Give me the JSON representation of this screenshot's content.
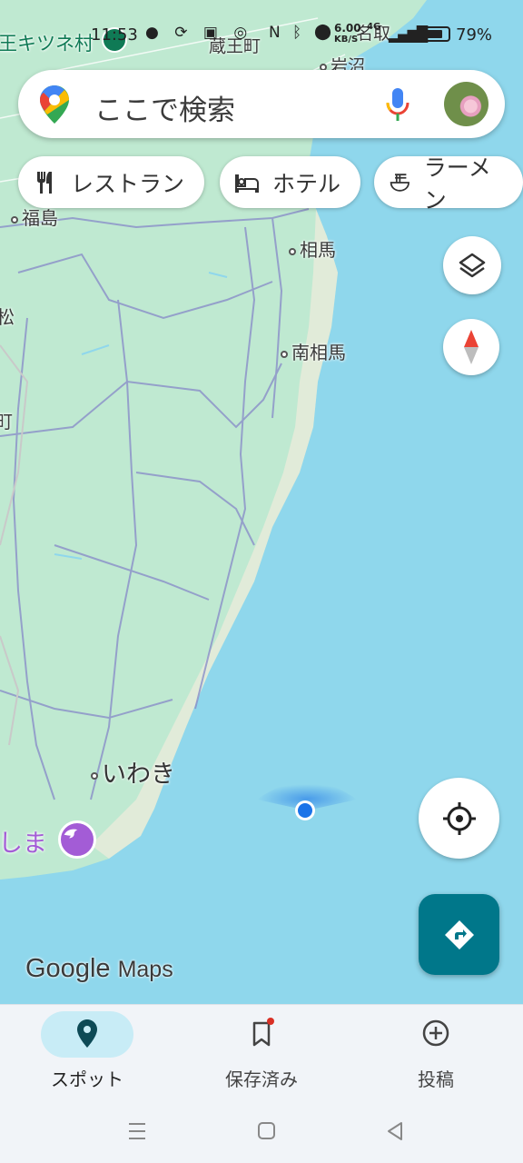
{
  "status_bar": {
    "time": "11:53",
    "network_speed_value": "6.00",
    "network_speed_unit": "KB/S",
    "network_type": "4G",
    "battery_percent": "79%",
    "battery_level": 0.79
  },
  "search": {
    "placeholder": "ここで検索",
    "icons": [
      "maps-pin-icon",
      "mic-icon",
      "avatar"
    ]
  },
  "chips": [
    {
      "label": "レストラン",
      "icon": "restaurant-icon"
    },
    {
      "label": "ホテル",
      "icon": "hotel-icon"
    },
    {
      "label": "ラーメン",
      "icon": "ramen-icon"
    }
  ],
  "map_labels": {
    "kitsune": "王キツネ村",
    "zao": "蔵王町",
    "iwanuma": "岩沼",
    "natori": "名取",
    "fukushima": "福島",
    "soma": "相馬",
    "minamisoma": "南相馬",
    "iwaki": "いわき",
    "aquamarine": "しま",
    "edge_matsu": "松",
    "edge_machi": "町"
  },
  "map_logo": {
    "google": "Google",
    "maps": "Maps"
  },
  "bottom_nav": [
    {
      "label": "スポット",
      "icon": "location-pin-icon",
      "active": true
    },
    {
      "label": "保存済み",
      "icon": "bookmark-icon",
      "active": false,
      "has_badge": true
    },
    {
      "label": "投稿",
      "icon": "add-circle-icon",
      "active": false
    }
  ],
  "colors": {
    "water": "#8fd7ec",
    "land": "#bfe9d1",
    "accent": "#00778a",
    "active_pill": "#c8ecf6",
    "location_dot": "#1a73e8"
  }
}
